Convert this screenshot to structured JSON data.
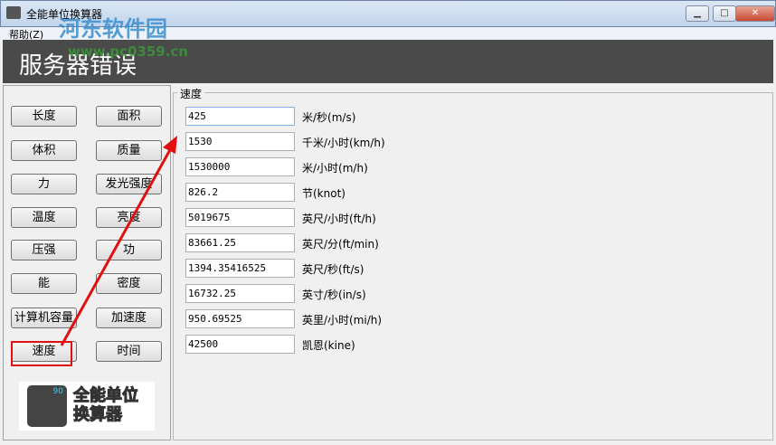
{
  "window": {
    "title": "全能单位换算器",
    "min": "▁",
    "max": "□",
    "close": "✕"
  },
  "menu": {
    "help": "帮助(Z)"
  },
  "banner": {
    "text": "服务器错误"
  },
  "watermark": {
    "site": "河东软件园",
    "url": "www.pc0359.cn"
  },
  "categories": [
    "长度",
    "面积",
    "体积",
    "质量",
    "力",
    "发光强度",
    "温度",
    "亮度",
    "压强",
    "功",
    "能",
    "密度",
    "计算机容量",
    "加速度",
    "速度",
    "时间"
  ],
  "group": {
    "title": "速度",
    "rows": [
      {
        "value": "425",
        "unit": "米/秒(m/s)"
      },
      {
        "value": "1530",
        "unit": "千米/小时(km/h)"
      },
      {
        "value": "1530000",
        "unit": "米/小时(m/h)"
      },
      {
        "value": "826.2",
        "unit": "节(knot)"
      },
      {
        "value": "5019675",
        "unit": "英尺/小时(ft/h)"
      },
      {
        "value": "83661.25",
        "unit": "英尺/分(ft/min)"
      },
      {
        "value": "1394.35416525",
        "unit": "英尺/秒(ft/s)"
      },
      {
        "value": "16732.25",
        "unit": "英寸/秒(in/s)"
      },
      {
        "value": "950.69525",
        "unit": "英里/小时(mi/h)"
      },
      {
        "value": "42500",
        "unit": "凯恩(kine)"
      }
    ]
  },
  "logo": {
    "text1": "全能单位",
    "text2": "换算器",
    "display": "90"
  }
}
